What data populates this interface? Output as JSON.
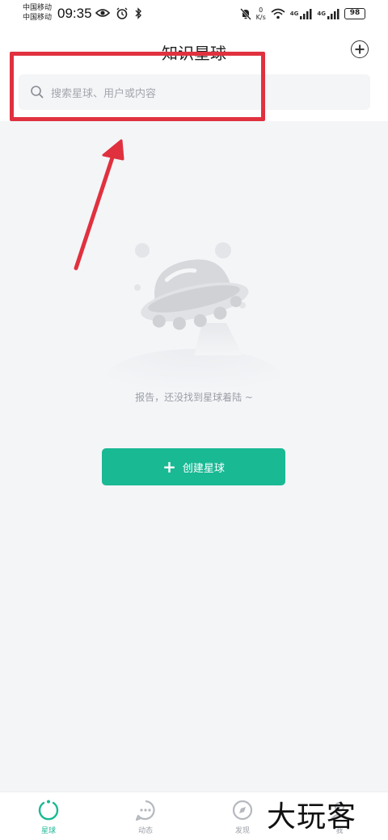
{
  "status_bar": {
    "carrier_1": "中国移动",
    "carrier_2": "中国移动",
    "time": "09:35",
    "speed_value": "0",
    "speed_unit": "K/s",
    "network_1": "4G",
    "network_2": "4G",
    "battery": "98"
  },
  "header": {
    "title": "知识星球"
  },
  "search": {
    "placeholder": "搜索星球、用户或内容"
  },
  "empty_state": {
    "message": "报告，还没找到星球着陆 ~",
    "create_label": "创建星球"
  },
  "bottom_nav": {
    "items": [
      {
        "label": "星球",
        "icon": "planet-icon",
        "active": true
      },
      {
        "label": "动态",
        "icon": "chat-icon",
        "active": false
      },
      {
        "label": "发现",
        "icon": "compass-icon",
        "active": false
      },
      {
        "label": "我",
        "icon": "person-icon",
        "active": false
      }
    ]
  },
  "watermark": "大玩客",
  "colors": {
    "accent": "#19b994",
    "annotation": "#e0313f",
    "background": "#f4f5f7"
  }
}
